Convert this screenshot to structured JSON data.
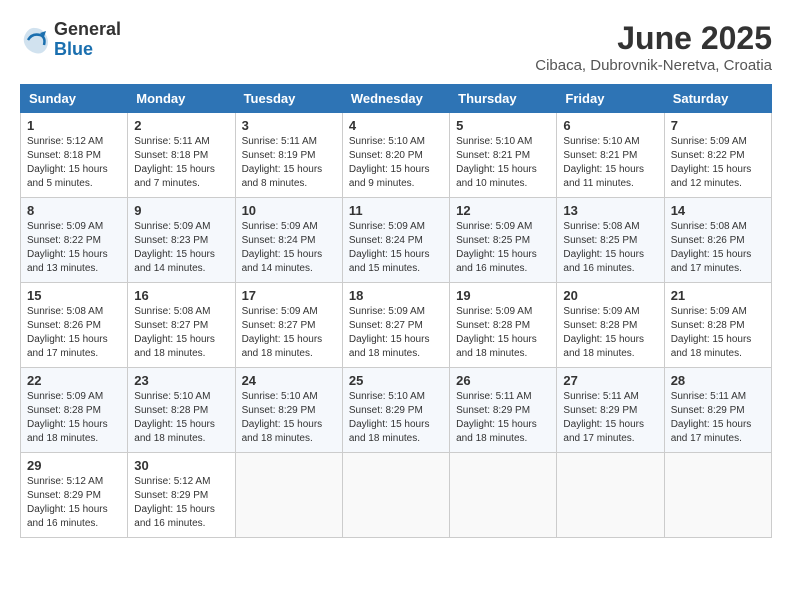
{
  "logo": {
    "general": "General",
    "blue": "Blue"
  },
  "title": "June 2025",
  "location": "Cibaca, Dubrovnik-Neretva, Croatia",
  "days_of_week": [
    "Sunday",
    "Monday",
    "Tuesday",
    "Wednesday",
    "Thursday",
    "Friday",
    "Saturday"
  ],
  "weeks": [
    [
      {
        "day": "1",
        "sunrise": "5:12 AM",
        "sunset": "8:18 PM",
        "daylight": "15 hours and 5 minutes."
      },
      {
        "day": "2",
        "sunrise": "5:11 AM",
        "sunset": "8:18 PM",
        "daylight": "15 hours and 7 minutes."
      },
      {
        "day": "3",
        "sunrise": "5:11 AM",
        "sunset": "8:19 PM",
        "daylight": "15 hours and 8 minutes."
      },
      {
        "day": "4",
        "sunrise": "5:10 AM",
        "sunset": "8:20 PM",
        "daylight": "15 hours and 9 minutes."
      },
      {
        "day": "5",
        "sunrise": "5:10 AM",
        "sunset": "8:21 PM",
        "daylight": "15 hours and 10 minutes."
      },
      {
        "day": "6",
        "sunrise": "5:10 AM",
        "sunset": "8:21 PM",
        "daylight": "15 hours and 11 minutes."
      },
      {
        "day": "7",
        "sunrise": "5:09 AM",
        "sunset": "8:22 PM",
        "daylight": "15 hours and 12 minutes."
      }
    ],
    [
      {
        "day": "8",
        "sunrise": "5:09 AM",
        "sunset": "8:22 PM",
        "daylight": "15 hours and 13 minutes."
      },
      {
        "day": "9",
        "sunrise": "5:09 AM",
        "sunset": "8:23 PM",
        "daylight": "15 hours and 14 minutes."
      },
      {
        "day": "10",
        "sunrise": "5:09 AM",
        "sunset": "8:24 PM",
        "daylight": "15 hours and 14 minutes."
      },
      {
        "day": "11",
        "sunrise": "5:09 AM",
        "sunset": "8:24 PM",
        "daylight": "15 hours and 15 minutes."
      },
      {
        "day": "12",
        "sunrise": "5:09 AM",
        "sunset": "8:25 PM",
        "daylight": "15 hours and 16 minutes."
      },
      {
        "day": "13",
        "sunrise": "5:08 AM",
        "sunset": "8:25 PM",
        "daylight": "15 hours and 16 minutes."
      },
      {
        "day": "14",
        "sunrise": "5:08 AM",
        "sunset": "8:26 PM",
        "daylight": "15 hours and 17 minutes."
      }
    ],
    [
      {
        "day": "15",
        "sunrise": "5:08 AM",
        "sunset": "8:26 PM",
        "daylight": "15 hours and 17 minutes."
      },
      {
        "day": "16",
        "sunrise": "5:08 AM",
        "sunset": "8:27 PM",
        "daylight": "15 hours and 18 minutes."
      },
      {
        "day": "17",
        "sunrise": "5:09 AM",
        "sunset": "8:27 PM",
        "daylight": "15 hours and 18 minutes."
      },
      {
        "day": "18",
        "sunrise": "5:09 AM",
        "sunset": "8:27 PM",
        "daylight": "15 hours and 18 minutes."
      },
      {
        "day": "19",
        "sunrise": "5:09 AM",
        "sunset": "8:28 PM",
        "daylight": "15 hours and 18 minutes."
      },
      {
        "day": "20",
        "sunrise": "5:09 AM",
        "sunset": "8:28 PM",
        "daylight": "15 hours and 18 minutes."
      },
      {
        "day": "21",
        "sunrise": "5:09 AM",
        "sunset": "8:28 PM",
        "daylight": "15 hours and 18 minutes."
      }
    ],
    [
      {
        "day": "22",
        "sunrise": "5:09 AM",
        "sunset": "8:28 PM",
        "daylight": "15 hours and 18 minutes."
      },
      {
        "day": "23",
        "sunrise": "5:10 AM",
        "sunset": "8:28 PM",
        "daylight": "15 hours and 18 minutes."
      },
      {
        "day": "24",
        "sunrise": "5:10 AM",
        "sunset": "8:29 PM",
        "daylight": "15 hours and 18 minutes."
      },
      {
        "day": "25",
        "sunrise": "5:10 AM",
        "sunset": "8:29 PM",
        "daylight": "15 hours and 18 minutes."
      },
      {
        "day": "26",
        "sunrise": "5:11 AM",
        "sunset": "8:29 PM",
        "daylight": "15 hours and 18 minutes."
      },
      {
        "day": "27",
        "sunrise": "5:11 AM",
        "sunset": "8:29 PM",
        "daylight": "15 hours and 17 minutes."
      },
      {
        "day": "28",
        "sunrise": "5:11 AM",
        "sunset": "8:29 PM",
        "daylight": "15 hours and 17 minutes."
      }
    ],
    [
      {
        "day": "29",
        "sunrise": "5:12 AM",
        "sunset": "8:29 PM",
        "daylight": "15 hours and 16 minutes."
      },
      {
        "day": "30",
        "sunrise": "5:12 AM",
        "sunset": "8:29 PM",
        "daylight": "15 hours and 16 minutes."
      },
      null,
      null,
      null,
      null,
      null
    ]
  ],
  "labels": {
    "sunrise": "Sunrise:",
    "sunset": "Sunset:",
    "daylight": "Daylight:"
  }
}
